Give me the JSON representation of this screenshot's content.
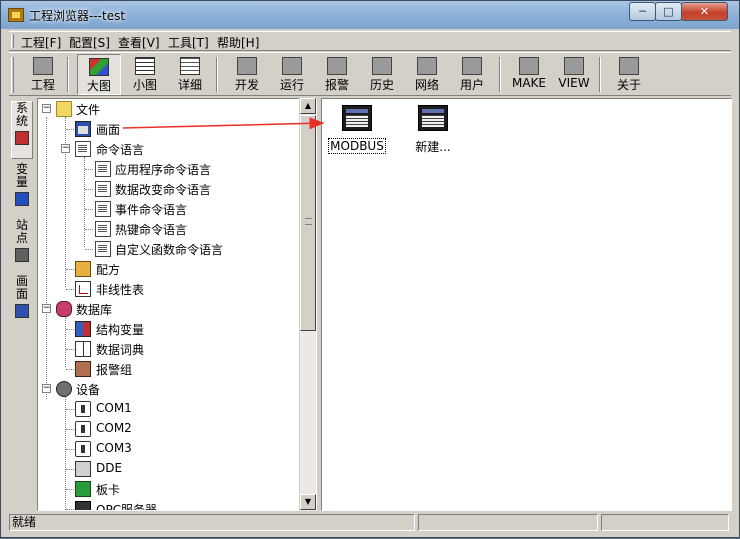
{
  "window": {
    "title": "工程浏览器---test"
  },
  "caption_buttons": {
    "minimize": "─",
    "maximize": "□",
    "close": "✕"
  },
  "menu": [
    "工程[F]",
    "配置[S]",
    "查看[V]",
    "工具[T]",
    "帮助[H]"
  ],
  "toolbar": [
    {
      "label": "工程",
      "icon": "project-icon"
    },
    {
      "label": "大图",
      "icon": "large-icons-icon",
      "pressed": true
    },
    {
      "label": "小图",
      "icon": "small-icons-icon"
    },
    {
      "label": "详细",
      "icon": "details-icon"
    },
    {
      "label": "开发",
      "icon": "develop-icon"
    },
    {
      "label": "运行",
      "icon": "run-icon"
    },
    {
      "label": "报警",
      "icon": "alarm-icon"
    },
    {
      "label": "历史",
      "icon": "history-icon"
    },
    {
      "label": "网络",
      "icon": "network-icon"
    },
    {
      "label": "用户",
      "icon": "user-icon"
    },
    {
      "label": "MAKE",
      "icon": "make-icon"
    },
    {
      "label": "VIEW",
      "icon": "view-icon"
    },
    {
      "label": "关于",
      "icon": "about-icon"
    }
  ],
  "side_tabs": [
    "系统",
    "变量",
    "站点",
    "画面"
  ],
  "tree": [
    {
      "label": "文件",
      "level": 0,
      "toggle": "−",
      "icon": "folder"
    },
    {
      "label": "画面",
      "level": 1,
      "icon": "screen"
    },
    {
      "label": "命令语言",
      "level": 1,
      "toggle": "−",
      "icon": "doc"
    },
    {
      "label": "应用程序命令语言",
      "level": 2,
      "icon": "doc"
    },
    {
      "label": "数据改变命令语言",
      "level": 2,
      "icon": "doc"
    },
    {
      "label": "事件命令语言",
      "level": 2,
      "icon": "doc"
    },
    {
      "label": "热键命令语言",
      "level": 2,
      "icon": "doc"
    },
    {
      "label": "自定义函数命令语言",
      "level": 2,
      "icon": "doc"
    },
    {
      "label": "配方",
      "level": 1,
      "icon": "recipe"
    },
    {
      "label": "非线性表",
      "level": 1,
      "icon": "nonlin"
    },
    {
      "label": "数据库",
      "level": 0,
      "toggle": "−",
      "icon": "db"
    },
    {
      "label": "结构变量",
      "level": 1,
      "icon": "struct"
    },
    {
      "label": "数据词典",
      "level": 1,
      "icon": "dict"
    },
    {
      "label": "报警组",
      "level": 1,
      "icon": "alarmgrp"
    },
    {
      "label": "设备",
      "level": 0,
      "toggle": "−",
      "icon": "gear"
    },
    {
      "label": "COM1",
      "level": 1,
      "icon": "com"
    },
    {
      "label": "COM2",
      "level": 1,
      "icon": "com"
    },
    {
      "label": "COM3",
      "level": 1,
      "icon": "com"
    },
    {
      "label": "DDE",
      "level": 1,
      "icon": "dde"
    },
    {
      "label": "板卡",
      "level": 1,
      "icon": "card"
    },
    {
      "label": "OPC服务器",
      "level": 1,
      "icon": "opc"
    }
  ],
  "content_items": [
    {
      "label": "MODBUS",
      "selected": true
    },
    {
      "label": "新建..."
    }
  ],
  "status": {
    "main": "就绪",
    "panel2": "",
    "panel3": ""
  }
}
